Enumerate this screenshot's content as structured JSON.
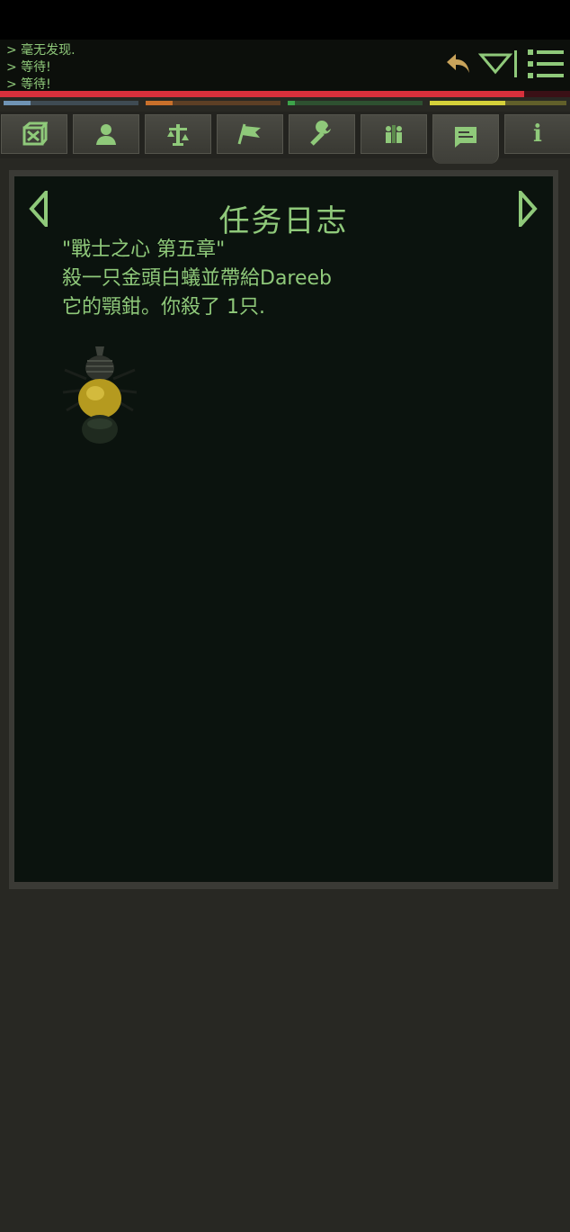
{
  "log": {
    "lines": [
      "> 毫无发现.",
      "> 等待!",
      "> 等待!"
    ]
  },
  "top_controls": {
    "icons": [
      "undo-icon",
      "dropdown-icon",
      "menu-icon"
    ]
  },
  "stats": {
    "hp_fraction": 0.92,
    "bars": [
      {
        "color": "#6f93b4",
        "fraction": 0.2
      },
      {
        "color": "#c9702b",
        "fraction": 0.2
      },
      {
        "color": "#3da34a",
        "fraction": 0.05
      },
      {
        "color": "#d4d03a",
        "fraction": 0.55
      }
    ]
  },
  "tabs": [
    {
      "icon": "inventory-icon",
      "active": false
    },
    {
      "icon": "character-icon",
      "active": false
    },
    {
      "icon": "balance-icon",
      "active": false
    },
    {
      "icon": "map-flag-icon",
      "active": false
    },
    {
      "icon": "wrench-icon",
      "active": false
    },
    {
      "icon": "party-icon",
      "active": false
    },
    {
      "icon": "journal-icon",
      "active": true
    },
    {
      "icon": "info-icon",
      "active": false
    }
  ],
  "info_tab": {
    "glyph": "i"
  },
  "journal": {
    "title": "任务日志",
    "quest_lines": [
      "\"戰士之心 第五章\"",
      "殺一只金頭白蟻並帶給Dareeb",
      "它的顎鉗。你殺了 1只."
    ],
    "image": "golden-headed-termite"
  },
  "colors": {
    "accent_green": "#8fc97a",
    "hp_red": "#d8303c",
    "panel_bg": "#0b130e"
  }
}
